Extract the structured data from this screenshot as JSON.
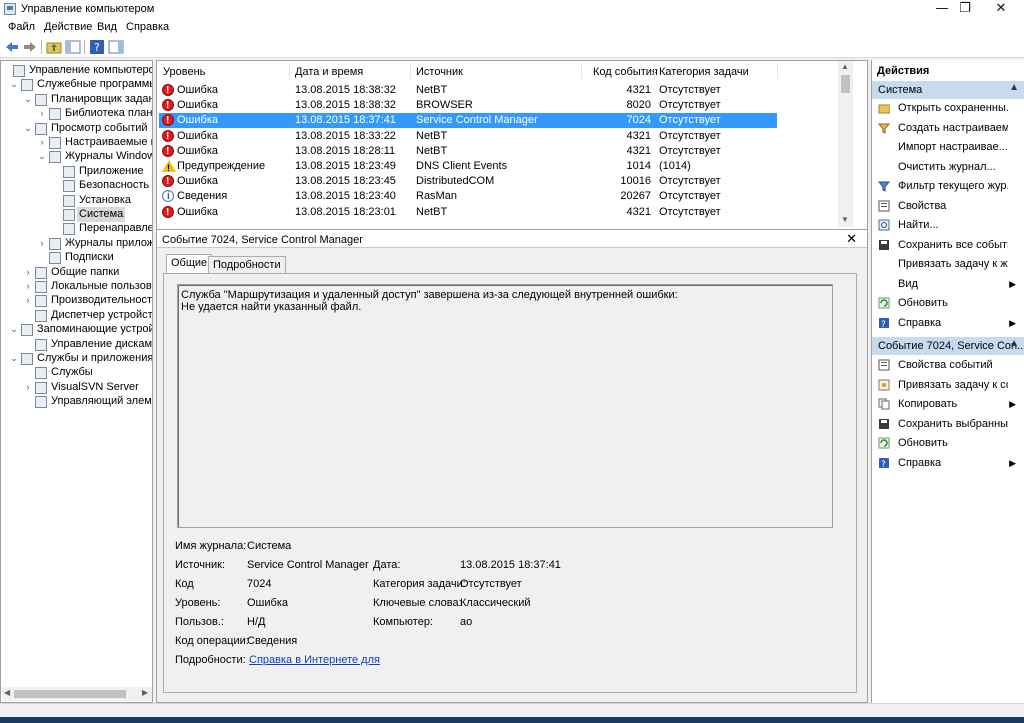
{
  "window": {
    "title": "Управление компьютером"
  },
  "menu": [
    "Файл",
    "Действие",
    "Вид",
    "Справка"
  ],
  "tree": [
    {
      "label": "Управление компьютером (л",
      "arrow": "",
      "indent": 0
    },
    {
      "label": "Служебные программы",
      "arrow": "⌄",
      "indent": 1
    },
    {
      "label": "Планировщик заданий",
      "arrow": "⌄",
      "indent": 2
    },
    {
      "label": "Библиотека планир",
      "arrow": "›",
      "indent": 3
    },
    {
      "label": "Просмотр событий",
      "arrow": "⌄",
      "indent": 2
    },
    {
      "label": "Настраиваемые пр",
      "arrow": "›",
      "indent": 3
    },
    {
      "label": "Журналы Windows",
      "arrow": "⌄",
      "indent": 3
    },
    {
      "label": "Приложение",
      "arrow": "",
      "indent": 4
    },
    {
      "label": "Безопасность",
      "arrow": "",
      "indent": 4
    },
    {
      "label": "Установка",
      "arrow": "",
      "indent": 4
    },
    {
      "label": "Система",
      "arrow": "",
      "indent": 4,
      "selected": true
    },
    {
      "label": "Перенаправлен",
      "arrow": "",
      "indent": 4
    },
    {
      "label": "Журналы приложе",
      "arrow": "›",
      "indent": 3
    },
    {
      "label": "Подписки",
      "arrow": "",
      "indent": 3
    },
    {
      "label": "Общие папки",
      "arrow": "›",
      "indent": 2
    },
    {
      "label": "Локальные пользовате",
      "arrow": "›",
      "indent": 2
    },
    {
      "label": "Производительность",
      "arrow": "›",
      "indent": 2
    },
    {
      "label": "Диспетчер устройств",
      "arrow": "",
      "indent": 2
    },
    {
      "label": "Запоминающие устройст",
      "arrow": "⌄",
      "indent": 1
    },
    {
      "label": "Управление дисками",
      "arrow": "",
      "indent": 2
    },
    {
      "label": "Службы и приложения",
      "arrow": "⌄",
      "indent": 1
    },
    {
      "label": "Службы",
      "arrow": "",
      "indent": 2
    },
    {
      "label": "VisualSVN Server",
      "arrow": "›",
      "indent": 2
    },
    {
      "label": "Управляющий элемен",
      "arrow": "",
      "indent": 2
    }
  ],
  "grid": {
    "columns": [
      "Уровень",
      "Дата и время",
      "Источник",
      "Код события",
      "Категория задачи"
    ],
    "rows": [
      {
        "level": "Ошибка",
        "icon": "error",
        "date": "13.08.2015 18:38:32",
        "source": "NetBT",
        "code": "4321",
        "category": "Отсутствует"
      },
      {
        "level": "Ошибка",
        "icon": "error",
        "date": "13.08.2015 18:38:32",
        "source": "BROWSER",
        "code": "8020",
        "category": "Отсутствует"
      },
      {
        "level": "Ошибка",
        "icon": "error",
        "date": "13.08.2015 18:37:41",
        "source": "Service Control Manager",
        "code": "7024",
        "category": "Отсутствует",
        "selected": true
      },
      {
        "level": "Ошибка",
        "icon": "error",
        "date": "13.08.2015 18:33:22",
        "source": "NetBT",
        "code": "4321",
        "category": "Отсутствует"
      },
      {
        "level": "Ошибка",
        "icon": "error",
        "date": "13.08.2015 18:28:11",
        "source": "NetBT",
        "code": "4321",
        "category": "Отсутствует"
      },
      {
        "level": "Предупреждение",
        "icon": "warning",
        "date": "13.08.2015 18:23:49",
        "source": "DNS Client Events",
        "code": "1014",
        "category": "(1014)"
      },
      {
        "level": "Ошибка",
        "icon": "error",
        "date": "13.08.2015 18:23:45",
        "source": "DistributedCOM",
        "code": "10016",
        "category": "Отсутствует"
      },
      {
        "level": "Сведения",
        "icon": "info",
        "date": "13.08.2015 18:23:40",
        "source": "RasMan",
        "code": "20267",
        "category": "Отсутствует"
      },
      {
        "level": "Ошибка",
        "icon": "error",
        "date": "13.08.2015 18:23:01",
        "source": "NetBT",
        "code": "4321",
        "category": "Отсутствует"
      }
    ]
  },
  "detail": {
    "title": "Событие 7024, Service Control Manager",
    "tabs": [
      "Общие",
      "Подробности"
    ],
    "message_line1": "Служба \"Маршрутизация и удаленный доступ\" завершена из-за следующей внутренней ошибки:",
    "message_line2": "Не удается найти указанный файл.",
    "fields": {
      "log_label": "Имя журнала:",
      "log_value": "Система",
      "source_label": "Источник:",
      "source_value": "Service Control Manager",
      "date_label": "Дата:",
      "date_value": "13.08.2015 18:37:41",
      "code_label": "Код",
      "code_value": "7024",
      "category_label": "Категория задачи:",
      "category_value": "Отсутствует",
      "level_label": "Уровень:",
      "level_value": "Ошибка",
      "keywords_label": "Ключевые слова:",
      "keywords_value": "Классический",
      "user_label": "Пользов.:",
      "user_value": "Н/Д",
      "computer_label": "Компьютер:",
      "computer_value": "ao",
      "opcode_label": "Код операции:",
      "opcode_value": "Сведения",
      "more_label": "Подробности:",
      "more_link": "Справка в Интернете для"
    }
  },
  "actions": {
    "title": "Действия",
    "section1": "Система",
    "section1_items": [
      {
        "label": "Открыть сохраненны...",
        "icon": "open-folder-icon",
        "submenu": false
      },
      {
        "label": "Создать настраиваем...",
        "icon": "filter-create-icon",
        "submenu": false
      },
      {
        "label": "Импорт настраивае...",
        "icon": "",
        "submenu": false
      },
      {
        "label": "Очистить журнал...",
        "icon": "",
        "submenu": false
      },
      {
        "label": "Фильтр текущего жур...",
        "icon": "filter-icon",
        "submenu": false
      },
      {
        "label": "Свойства",
        "icon": "properties-icon",
        "submenu": false
      },
      {
        "label": "Найти...",
        "icon": "find-icon",
        "submenu": false
      },
      {
        "label": "Сохранить все событи...",
        "icon": "save-icon",
        "submenu": false
      },
      {
        "label": "Привязать задачу к жу...",
        "icon": "",
        "submenu": false
      },
      {
        "label": "Вид",
        "icon": "",
        "submenu": true
      },
      {
        "label": "Обновить",
        "icon": "refresh-icon",
        "submenu": false
      },
      {
        "label": "Справка",
        "icon": "help-icon",
        "submenu": true
      }
    ],
    "section2": "Событие 7024, Service Con...",
    "section2_items": [
      {
        "label": "Свойства событий",
        "icon": "event-properties-icon",
        "submenu": false
      },
      {
        "label": "Привязать задачу к со...",
        "icon": "attach-task-icon",
        "submenu": false
      },
      {
        "label": "Копировать",
        "icon": "copy-icon",
        "submenu": true
      },
      {
        "label": "Сохранить выбранны...",
        "icon": "save-icon",
        "submenu": false
      },
      {
        "label": "Обновить",
        "icon": "refresh-icon",
        "submenu": false
      },
      {
        "label": "Справка",
        "icon": "help-icon",
        "submenu": true
      }
    ]
  }
}
